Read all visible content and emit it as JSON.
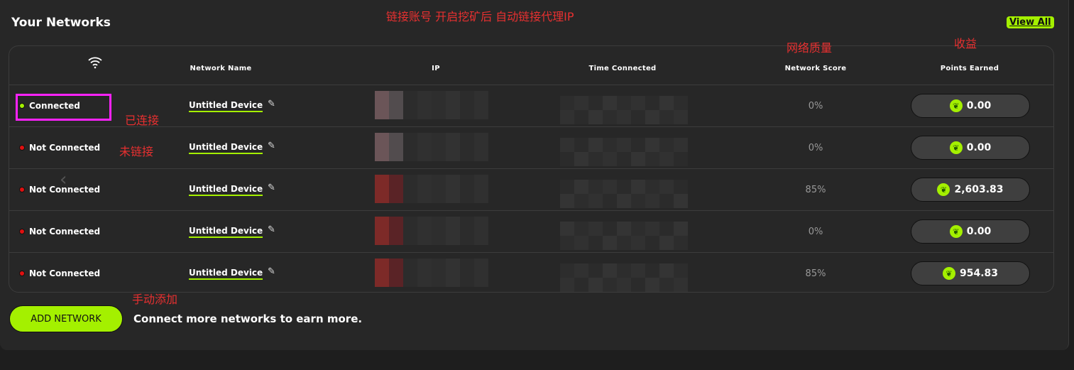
{
  "title": "Your Networks",
  "view_all": "View All",
  "headers": {
    "wifi_icon": "wifi-icon",
    "network_name": "Network Name",
    "ip": "IP",
    "time_connected": "Time Connected",
    "network_score": "Network Score",
    "points_earned": "Points Earned"
  },
  "rows": [
    {
      "status": "Connected",
      "status_color": "#a4f000",
      "name": "Untitled Device",
      "score": "0%",
      "points": "0.00"
    },
    {
      "status": "Not Connected",
      "status_color": "#e01010",
      "name": "Untitled Device",
      "score": "0%",
      "points": "0.00"
    },
    {
      "status": "Not Connected",
      "status_color": "#e01010",
      "name": "Untitled Device",
      "score": "85%",
      "points": "2,603.83"
    },
    {
      "status": "Not Connected",
      "status_color": "#e01010",
      "name": "Untitled Device",
      "score": "0%",
      "points": "0.00"
    },
    {
      "status": "Not Connected",
      "status_color": "#e01010",
      "name": "Untitled Device",
      "score": "85%",
      "points": "954.83"
    }
  ],
  "add_network": "ADD NETWORK",
  "add_hint": "Connect more networks to earn more.",
  "annotations": {
    "top": "链接账号 开启挖矿后 自动链接代理IP",
    "score": "网络质量",
    "points": "收益",
    "connected": "已连接",
    "not_connected": "未链接",
    "manual": "手动添加"
  },
  "colors": {
    "accent": "#a4f000",
    "panel": "#272727"
  }
}
